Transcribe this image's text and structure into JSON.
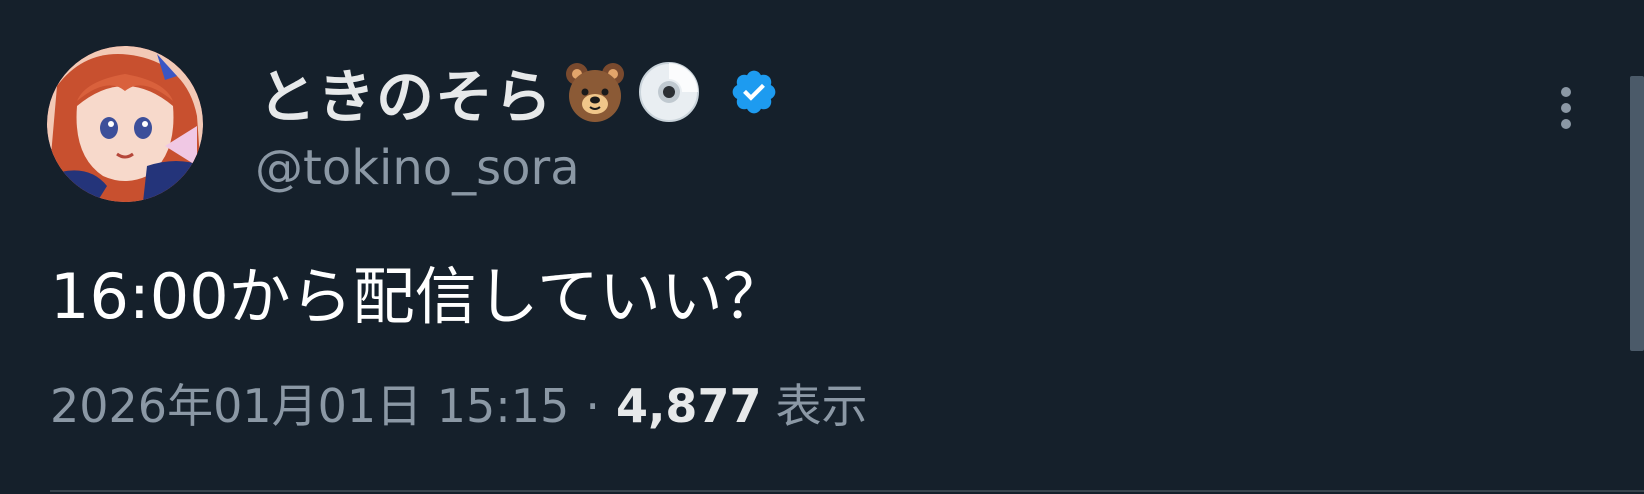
{
  "tweet": {
    "display_name": "ときのそら",
    "name_emojis": [
      "bear-face-emoji",
      "optical-disc-emoji"
    ],
    "verified": true,
    "handle": "@tokino_sora",
    "text": "16:00から配信していい？",
    "timestamp": "2026年01月01日 15:15",
    "separator": "·",
    "views_count": "4,877",
    "views_label": "表示"
  },
  "colors": {
    "background": "#15202b",
    "primary_text": "#e7e9ea",
    "secondary_text": "#8b98a5",
    "verified_badge": "#1d9bf0",
    "divider": "#38444d"
  },
  "icons": {
    "more": "more-vertical-icon",
    "verified": "verified-badge-icon"
  }
}
